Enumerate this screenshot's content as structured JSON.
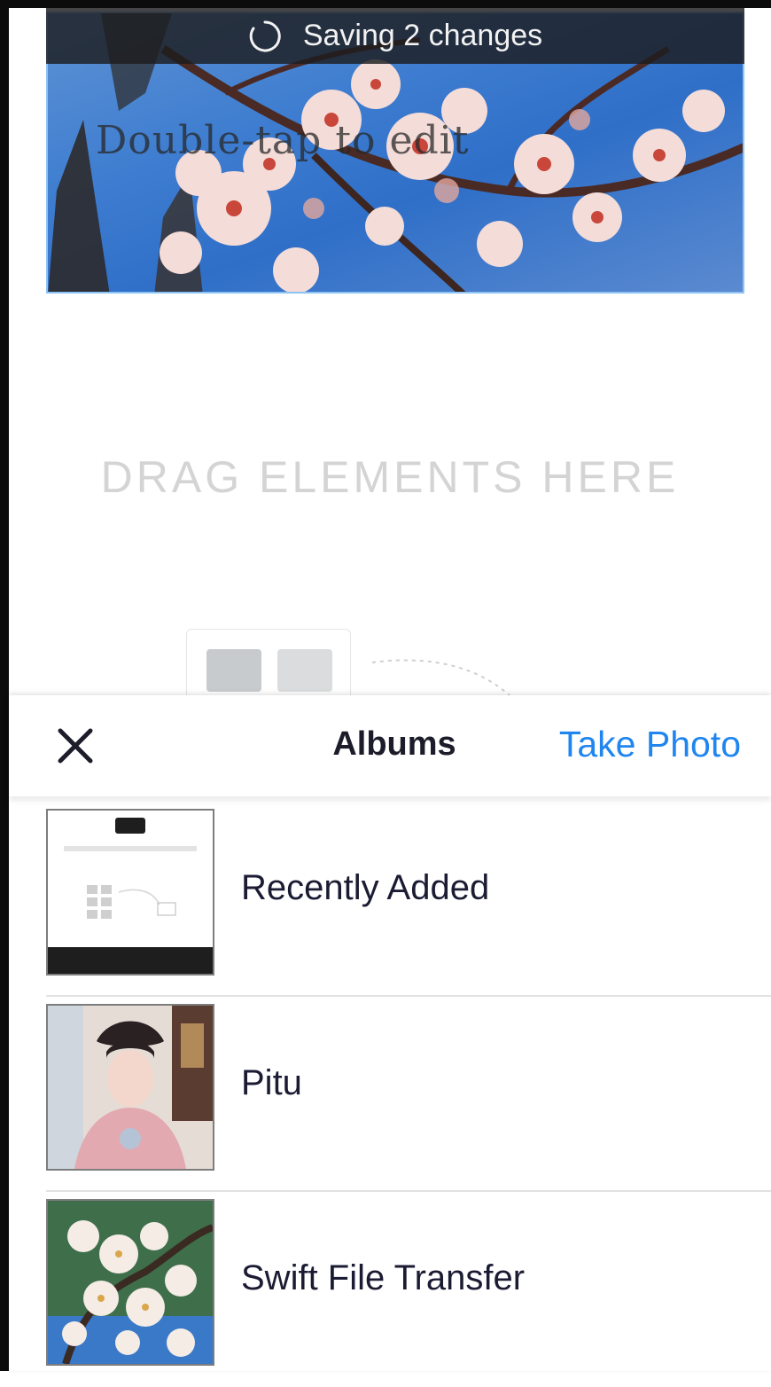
{
  "status": {
    "saving_text": "Saving 2 changes"
  },
  "canvas": {
    "hero_text": "Double-tap to edit",
    "drag_hint": "DRAG ELEMENTS HERE"
  },
  "sheet": {
    "close_label": "✕",
    "title": "Albums",
    "action": "Take Photo",
    "albums": [
      {
        "label": "Recently Added",
        "thumb": "screenshot-thumbnail"
      },
      {
        "label": "Pitu",
        "thumb": "portrait-photo"
      },
      {
        "label": "Swift File Transfer",
        "thumb": "blossom-photo"
      }
    ]
  },
  "colors": {
    "accent": "#1f86f0",
    "title": "#1c1c2a",
    "hint": "#d4d4d4"
  }
}
